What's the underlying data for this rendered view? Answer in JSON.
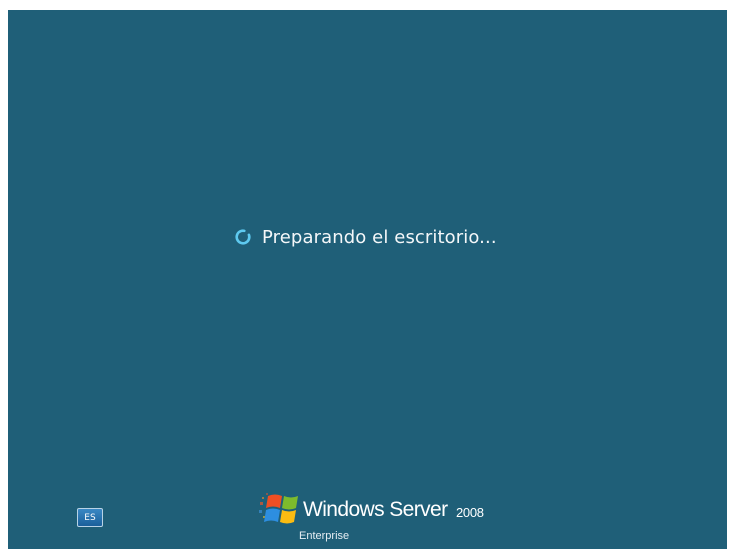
{
  "status": {
    "message": "Preparando el escritorio...",
    "icon": "loading-spinner-icon"
  },
  "language_indicator": {
    "label": "ES"
  },
  "branding": {
    "product_name": "Windows Server",
    "version": "2008",
    "edition": "Enterprise",
    "logo_icon": "windows-flag-icon"
  },
  "colors": {
    "background": "#1f5f78",
    "text": "#f4f7f9",
    "spinner": "#5ec9ef"
  }
}
